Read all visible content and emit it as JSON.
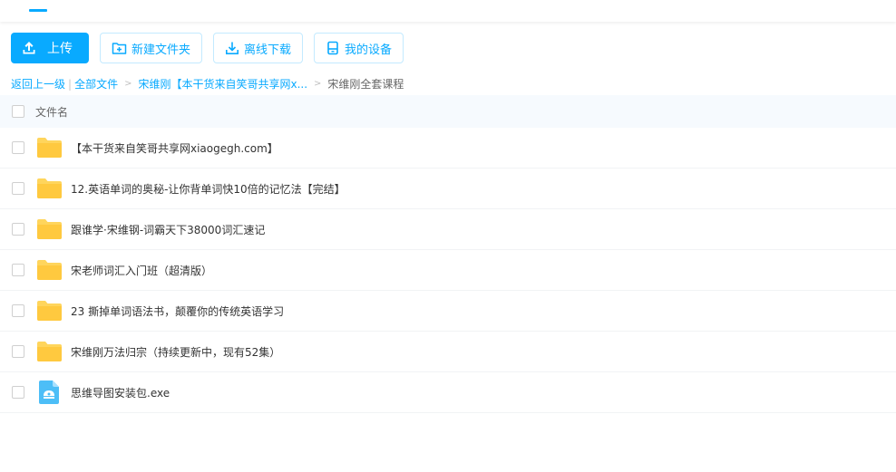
{
  "toolbar": {
    "upload_label": "上传",
    "new_folder_label": "新建文件夹",
    "offline_download_label": "离线下载",
    "my_devices_label": "我的设备"
  },
  "breadcrumb": {
    "back_label": "返回上一级",
    "separator": "|",
    "all_files_label": "全部文件",
    "arrow": ">",
    "folder_label": "宋维刚【本干货来自笑哥共享网x...",
    "current_label": "宋维刚全套课程"
  },
  "table": {
    "header_label": "文件名"
  },
  "files": [
    {
      "name": "【本干货来自笑哥共享网xiaogegh.com】",
      "icon": "folder-icon"
    },
    {
      "name": "12.英语单词的奥秘-让你背单词快10倍的记忆法【完结】",
      "icon": "folder-icon"
    },
    {
      "name": "跟谁学·宋维钢-词霸天下38000词汇速记",
      "icon": "folder-icon"
    },
    {
      "name": "宋老师词汇入门班（超清版）",
      "icon": "folder-icon"
    },
    {
      "name": "23 撕掉单词语法书，颠覆你的传统英语学习",
      "icon": "folder-icon"
    },
    {
      "name": "宋维刚万法归宗（持续更新中，现有52集）",
      "icon": "folder-icon"
    },
    {
      "name": "思维导图安装包.exe",
      "icon": "exe-file-icon"
    }
  ],
  "colors": {
    "accent": "#09aaff",
    "folder": "#ffd55c",
    "header_bg": "#f6fafe"
  }
}
